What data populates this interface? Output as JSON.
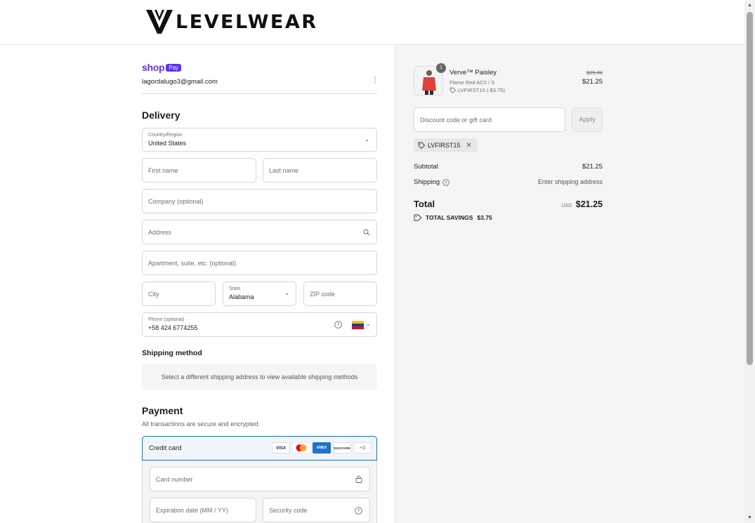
{
  "brand": {
    "name": "LEVELWEAR"
  },
  "contact": {
    "email": "lagordalugo3@gmail.com"
  },
  "shop_pay": {
    "shop": "shop",
    "pay": "Pay"
  },
  "delivery": {
    "title": "Delivery",
    "country_label": "Country/Region",
    "country_value": "United States",
    "first_name_placeholder": "First name",
    "last_name_placeholder": "Last name",
    "company_placeholder": "Company (optional)",
    "address_placeholder": "Address",
    "apartment_placeholder": "Apartment, suite, etc. (optional)",
    "city_placeholder": "City",
    "state_label": "State",
    "state_value": "Alabama",
    "zip_placeholder": "ZIP code",
    "phone_label": "Phone (optional)",
    "phone_value": "+58 424 6774255"
  },
  "shipping_method": {
    "title": "Shipping method",
    "message": "Select a different shipping address to view available shipping methods"
  },
  "payment": {
    "title": "Payment",
    "subtitle": "All transactions are secure and encrypted.",
    "method_label": "Credit card",
    "brands": [
      "VISA",
      "Mastercard",
      "AMEX",
      "DISCOVER"
    ],
    "more_brands": "+3",
    "card_number_placeholder": "Card number",
    "expiration_placeholder": "Expiration date (MM / YY)",
    "security_placeholder": "Security code"
  },
  "order": {
    "item": {
      "quantity": "1",
      "name": "Verve™ Paisley",
      "variant": "Flame Red AC0 / S",
      "discount_tag": "LVFIRST15 (-$3.75)",
      "original_price": "$25.00",
      "price": "$21.25"
    },
    "discount_placeholder": "Discount code or gift card",
    "apply_label": "Apply",
    "applied_code": "LVFIRST15",
    "subtotal_label": "Subtotal",
    "subtotal_value": "$21.25",
    "shipping_label": "Shipping",
    "shipping_value": "Enter shipping address",
    "total_label": "Total",
    "currency": "USD",
    "total_value": "$21.25",
    "savings_label": "TOTAL SAVINGS",
    "savings_value": "$3.75"
  },
  "colors": {
    "shop_pay_purple": "#5a31f4",
    "selected_border": "#1773b0"
  }
}
